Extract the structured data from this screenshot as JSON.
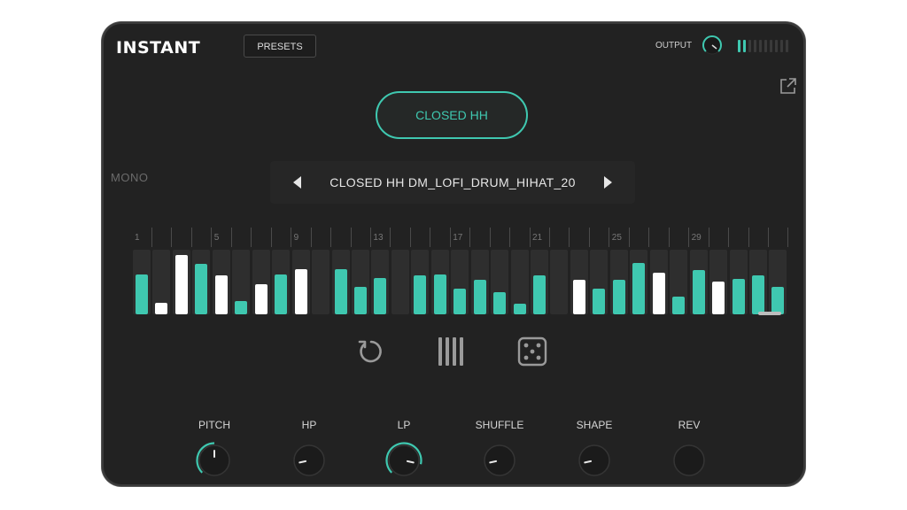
{
  "header": {
    "logo": "INSTANT",
    "presets_label": "PRESETS",
    "output_label": "OUTPUT",
    "meter_lit": 2,
    "meter_total": 10
  },
  "sample": {
    "type_label": "CLOSED HH",
    "mode_label": "MONO",
    "name": "CLOSED HH DM_LOFI_DRUM_HIHAT_20"
  },
  "sequencer": {
    "step_numbers": [
      "1",
      "5",
      "9",
      "13",
      "17",
      "21",
      "25",
      "29"
    ],
    "steps": [
      {
        "level": 0.62,
        "color": "teal"
      },
      {
        "level": 0.18,
        "color": "white"
      },
      {
        "level": 0.92,
        "color": "white"
      },
      {
        "level": 0.78,
        "color": "teal"
      },
      {
        "level": 0.6,
        "color": "white"
      },
      {
        "level": 0.2,
        "color": "teal"
      },
      {
        "level": 0.46,
        "color": "white"
      },
      {
        "level": 0.62,
        "color": "teal"
      },
      {
        "level": 0.7,
        "color": "white"
      },
      {
        "level": 0,
        "color": "none"
      },
      {
        "level": 0.7,
        "color": "teal"
      },
      {
        "level": 0.42,
        "color": "teal"
      },
      {
        "level": 0.56,
        "color": "teal"
      },
      {
        "level": 0,
        "color": "none"
      },
      {
        "level": 0.6,
        "color": "teal"
      },
      {
        "level": 0.62,
        "color": "teal"
      },
      {
        "level": 0.4,
        "color": "teal"
      },
      {
        "level": 0.53,
        "color": "teal"
      },
      {
        "level": 0.34,
        "color": "teal"
      },
      {
        "level": 0.16,
        "color": "teal"
      },
      {
        "level": 0.6,
        "color": "teal"
      },
      {
        "level": 0,
        "color": "none"
      },
      {
        "level": 0.54,
        "color": "white"
      },
      {
        "level": 0.4,
        "color": "teal"
      },
      {
        "level": 0.53,
        "color": "teal"
      },
      {
        "level": 0.8,
        "color": "teal"
      },
      {
        "level": 0.65,
        "color": "white"
      },
      {
        "level": 0.28,
        "color": "teal"
      },
      {
        "level": 0.68,
        "color": "teal"
      },
      {
        "level": 0.5,
        "color": "white"
      },
      {
        "level": 0.55,
        "color": "teal"
      },
      {
        "level": 0.6,
        "color": "teal"
      },
      {
        "level": 0.43,
        "color": "teal"
      }
    ]
  },
  "tools": [
    "refresh-icon",
    "step-lanes-icon",
    "dice-icon"
  ],
  "knobs": [
    {
      "label": "PITCH",
      "value": 0.5,
      "arc": true
    },
    {
      "label": "HP",
      "value": 0.12,
      "arc": false
    },
    {
      "label": "LP",
      "value": 0.88,
      "arc": true
    },
    {
      "label": "SHUFFLE",
      "value": 0.12,
      "arc": false
    },
    {
      "label": "SHAPE",
      "value": 0.12,
      "arc": false
    },
    {
      "label": "REV",
      "value": 0,
      "arc": false
    }
  ],
  "colors": {
    "accent": "#3fc8b0",
    "white_bar": "#ffffff",
    "panel": "#222222"
  }
}
